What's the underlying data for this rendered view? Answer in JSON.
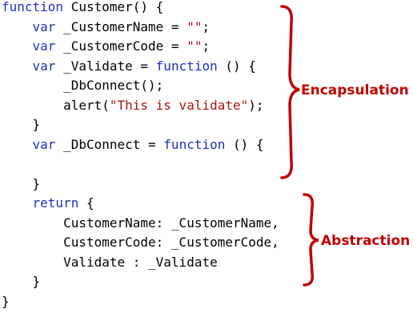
{
  "code_lines": [
    [
      {
        "t": "function",
        "c": "kw"
      },
      {
        "t": " Customer() {"
      }
    ],
    [
      {
        "t": "    "
      },
      {
        "t": "var",
        "c": "kw"
      },
      {
        "t": " _CustomerName = "
      },
      {
        "t": "\"\"",
        "c": "str"
      },
      {
        "t": ";"
      }
    ],
    [
      {
        "t": "    "
      },
      {
        "t": "var",
        "c": "kw"
      },
      {
        "t": " _CustomerCode = "
      },
      {
        "t": "\"\"",
        "c": "str"
      },
      {
        "t": ";"
      }
    ],
    [
      {
        "t": "    "
      },
      {
        "t": "var",
        "c": "kw"
      },
      {
        "t": " _Validate = "
      },
      {
        "t": "function",
        "c": "kw"
      },
      {
        "t": " () {"
      }
    ],
    [
      {
        "t": "        _DbConnect();"
      }
    ],
    [
      {
        "t": "        alert("
      },
      {
        "t": "\"This is validate\"",
        "c": "str"
      },
      {
        "t": ");"
      }
    ],
    [
      {
        "t": "    }"
      }
    ],
    [
      {
        "t": "    "
      },
      {
        "t": "var",
        "c": "kw"
      },
      {
        "t": " _DbConnect = "
      },
      {
        "t": "function",
        "c": "kw"
      },
      {
        "t": " () {"
      }
    ],
    [
      {
        "t": ""
      }
    ],
    [
      {
        "t": "    }"
      }
    ],
    [
      {
        "t": "    "
      },
      {
        "t": "return",
        "c": "kw"
      },
      {
        "t": " {"
      }
    ],
    [
      {
        "t": "        CustomerName: _CustomerName,"
      }
    ],
    [
      {
        "t": "        CustomerCode: _CustomerCode,"
      }
    ],
    [
      {
        "t": "        Validate : _Validate"
      }
    ],
    [
      {
        "t": "    }"
      }
    ],
    [
      {
        "t": "}"
      }
    ]
  ],
  "annotations": {
    "encapsulation": "Encapsulation",
    "abstraction": "Abstraction"
  },
  "colors": {
    "keyword": "#1f2fbf",
    "string": "#a31515",
    "annotation": "#c00000"
  }
}
